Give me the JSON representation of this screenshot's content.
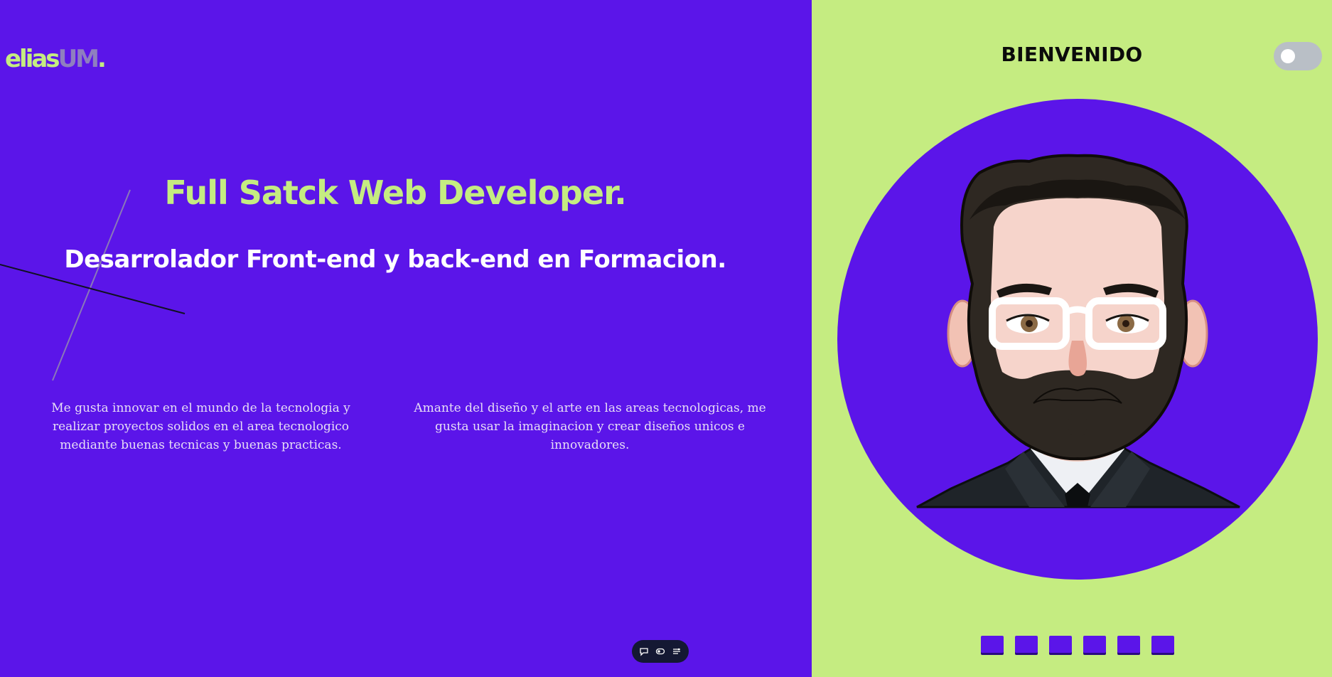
{
  "brand": {
    "logo_part1": "elias",
    "logo_part2": "UM",
    "logo_part3": "."
  },
  "hero": {
    "title": "Full Satck Web Developer.",
    "subtitle": "Desarrolador Front-end y back-end en Formacion."
  },
  "paragraphs": [
    {
      "text": "Me gusta innovar en el mundo de la tecnologia y realizar proyectos solidos en el area tecnologico mediante buenas tecnicas y buenas practicas."
    },
    {
      "text": "Amante del diseño y el arte en las areas tecnologicas, me gusta usar la imaginacion y crear diseños unicos e innovadores."
    }
  ],
  "right_panel": {
    "welcome": "BIENVENIDO",
    "theme_toggle_on": false
  },
  "toolbar_icons": [
    "chat-icon",
    "toggle-icon",
    "settings-list-icon"
  ],
  "pager": {
    "count": 6
  },
  "colors": {
    "primary": "#5b15e9",
    "accent": "#c5ec81",
    "text_light": "#ffffff"
  }
}
